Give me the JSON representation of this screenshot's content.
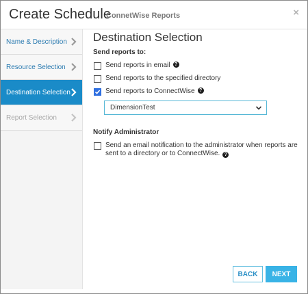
{
  "dialog": {
    "title": "Create Schedule",
    "subtitle": "ConnetWise Reports",
    "close_glyph": "×"
  },
  "sidebar": {
    "items": [
      {
        "label": "Name & Description",
        "state": "normal"
      },
      {
        "label": "Resource Selection",
        "state": "normal"
      },
      {
        "label": "Destination Selection",
        "state": "active"
      },
      {
        "label": "Report Selection",
        "state": "disabled"
      }
    ]
  },
  "main": {
    "section_title": "Destination Selection",
    "send_reports_label": "Send reports to:",
    "options": [
      {
        "label": "Send reports in email",
        "checked": false,
        "help": true
      },
      {
        "label": "Send reports to the specified directory",
        "checked": false,
        "help": false
      },
      {
        "label": "Send reports to ConnectWise",
        "checked": true,
        "help": true
      }
    ],
    "connectwise_select_value": "DimensionTest",
    "notify_title": "Notify Administrator",
    "notify_option": {
      "label": "Send an email notification to the administrator when reports are sent to a directory or to ConnectWise.",
      "checked": false
    },
    "help_glyph": "?"
  },
  "footer": {
    "back_label": "BACK",
    "next_label": "NEXT"
  },
  "icons": {
    "chevron": "chevron-right-icon",
    "help": "help-icon",
    "close": "close-icon",
    "caret": "chevron-down-icon"
  },
  "colors": {
    "accent": "#1a8bc8",
    "next_button": "#39b3e6",
    "link": "#2a7ab0",
    "checkbox_checked": "#2f6fe0"
  }
}
